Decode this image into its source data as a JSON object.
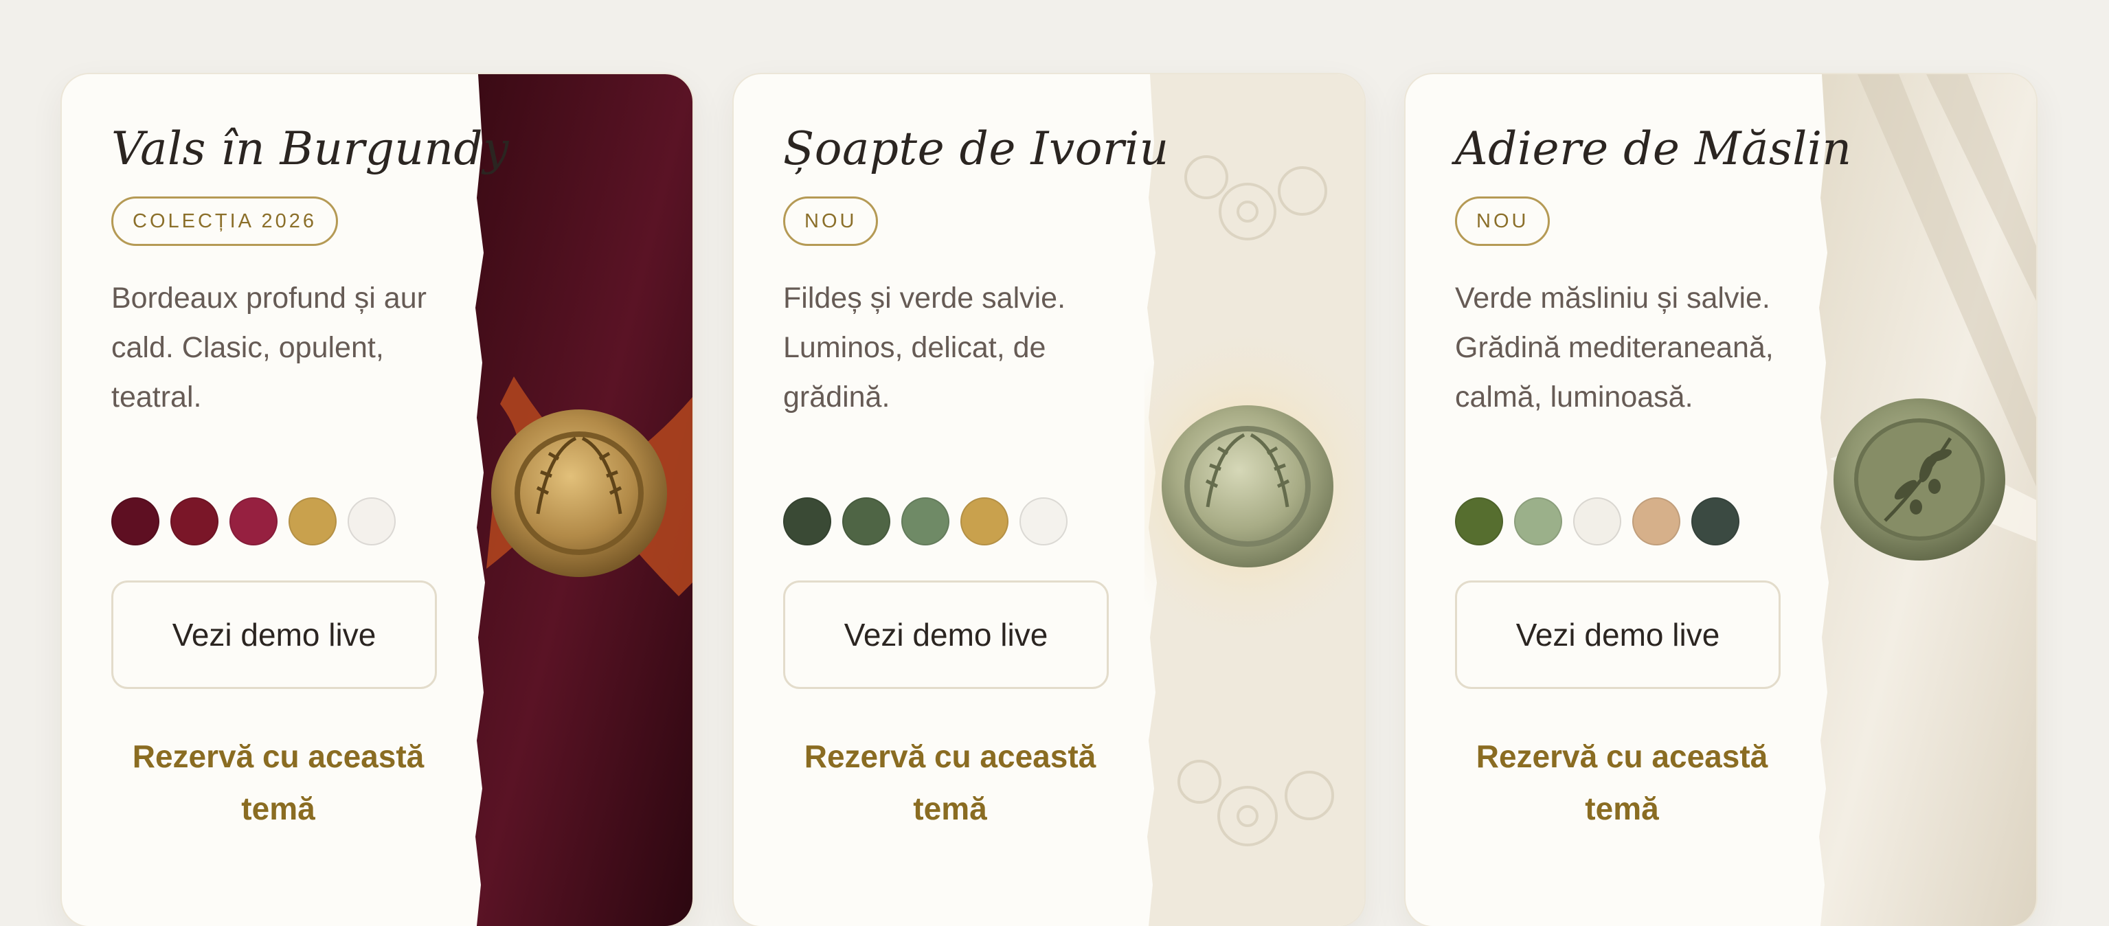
{
  "cards": [
    {
      "title": "Vals în Burgundy",
      "badge": "COLECȚIA 2026",
      "description": "Bordeaux profund și aur cald. Clasic, opulent, teatral.",
      "swatches": [
        "#5e0f22",
        "#7a1628",
        "#962040",
        "#c9a14d",
        "#f4f1ec"
      ],
      "demo_label": "Vezi demo live",
      "reserve_label": "Rezervă cu această temă"
    },
    {
      "title": "Șoapte de Ivoriu",
      "badge": "NOU",
      "description": "Fildeș și verde salvie. Luminos, delicat, de grădină.",
      "swatches": [
        "#3a4a35",
        "#4f6545",
        "#6f8a66",
        "#c9a14d",
        "#f4f2ed"
      ],
      "demo_label": "Vezi demo live",
      "reserve_label": "Rezervă cu această temă"
    },
    {
      "title": "Adiere de Măslin",
      "badge": "NOU",
      "description": "Verde măsliniu și salvie. Grădină mediteraneană, calmă, luminoasă.",
      "swatches": [
        "#566e2f",
        "#9bb08a",
        "#f2efe8",
        "#d6b08a",
        "#3b4a42"
      ],
      "demo_label": "Vezi demo live",
      "reserve_label": "Rezervă cu această temă"
    }
  ],
  "photos": [
    {
      "icon": "wax-seal-laurel-gold-icon",
      "paper": "#5a1325",
      "seal": "#b28a48",
      "ribbon": "#b4461f"
    },
    {
      "icon": "wax-seal-laurel-sage-icon",
      "paper": "#efe9dc",
      "seal": "#a8ac86",
      "ribbon": "#f3d79a"
    },
    {
      "icon": "wax-seal-olive-branch-icon",
      "paper": "#ece5d8",
      "seal": "#8f9670",
      "ribbon": "#f7f3ea"
    }
  ]
}
